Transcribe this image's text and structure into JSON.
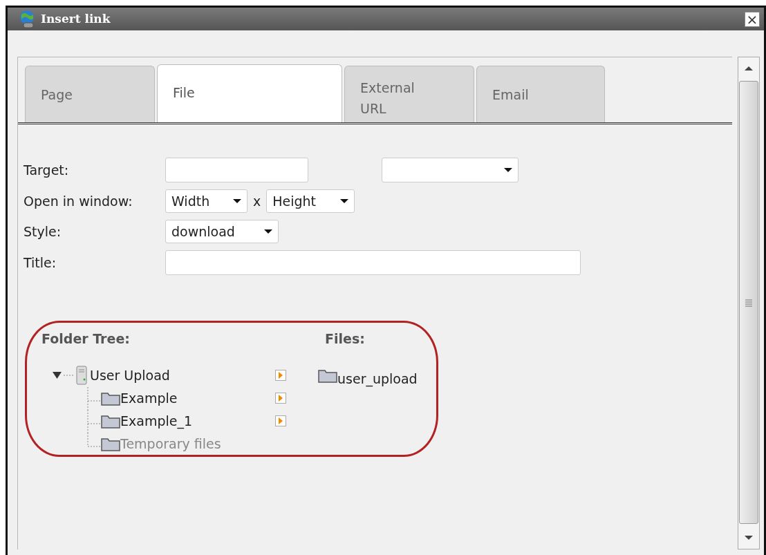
{
  "window": {
    "title": "Insert link",
    "close": "×"
  },
  "tabs": [
    {
      "label": "Page",
      "selected": false
    },
    {
      "label": "File",
      "selected": true
    },
    {
      "label": "External URL",
      "selected": false
    },
    {
      "label": "Email",
      "selected": false
    }
  ],
  "form": [
    {
      "label": "Target:",
      "kind": "target"
    },
    {
      "label": "Open in window:",
      "kind": "size",
      "width": "Width",
      "separator": "x",
      "height": "Height"
    },
    {
      "label": "Style:",
      "kind": "select",
      "value": "download"
    },
    {
      "label": "Title:",
      "kind": "text"
    }
  ],
  "folder_tree": {
    "heading": "Folder Tree:",
    "root": {
      "label": "User Upload",
      "expanded": true,
      "children": [
        {
          "label": "Example",
          "disabled": false
        },
        {
          "label": "Example_1",
          "disabled": false
        },
        {
          "label": "Temporary files",
          "disabled": true
        }
      ]
    }
  },
  "files": {
    "heading": "Files:",
    "items": [
      {
        "label": "user_upload"
      }
    ]
  }
}
